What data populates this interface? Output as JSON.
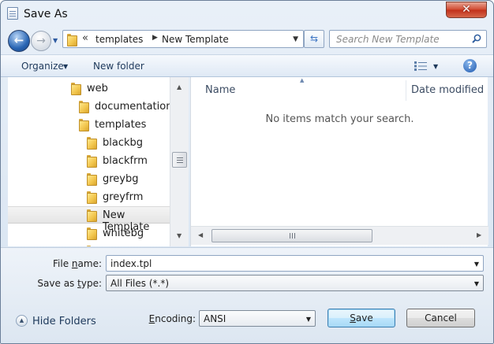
{
  "window": {
    "title": "Save As",
    "close_glyph": "✕"
  },
  "nav": {
    "back_glyph": "←",
    "forward_glyph": "→",
    "recent_glyph": "▼"
  },
  "address": {
    "chevron": "«",
    "segments": [
      "templates",
      "New Template"
    ],
    "separator": "▶",
    "dropdown_glyph": "▼"
  },
  "refresh_glyph": "⇆",
  "search": {
    "placeholder": "Search New Template"
  },
  "toolbar": {
    "organize": "Organize",
    "organize_arrow": "▼",
    "new_folder": "New folder",
    "views_arrow": "▼",
    "help_glyph": "?"
  },
  "tree": {
    "items": [
      {
        "label": "web"
      },
      {
        "label": "documentation"
      },
      {
        "label": "templates"
      },
      {
        "label": "blackbg"
      },
      {
        "label": "blackfrm"
      },
      {
        "label": "greybg"
      },
      {
        "label": "greyfrm"
      },
      {
        "label": "New Template",
        "selected": true
      },
      {
        "label": "whitebg"
      }
    ],
    "scroll_up": "▲",
    "scroll_down": "▼"
  },
  "files": {
    "columns": {
      "name": "Name",
      "date_modified": "Date modified"
    },
    "sort_glyph": "▲",
    "empty_message": "No items match your search.",
    "scroll_left": "◀",
    "scroll_right": "▶"
  },
  "form": {
    "file_name_label_a": "File ",
    "file_name_label_u": "n",
    "file_name_label_b": "ame:",
    "file_name_value": "index.tpl",
    "save_type_label_a": "Save as ",
    "save_type_label_u": "t",
    "save_type_label_b": "ype:",
    "save_type_value": "All Files  (*.*)",
    "encoding_label_u": "E",
    "encoding_label_b": "ncoding:",
    "encoding_value": "ANSI",
    "dropdown_glyph": "▼"
  },
  "bottom": {
    "hide_folders_glyph": "▲",
    "hide_folders": "Hide Folders",
    "save_u": "S",
    "save_b": "ave",
    "cancel": "Cancel"
  }
}
